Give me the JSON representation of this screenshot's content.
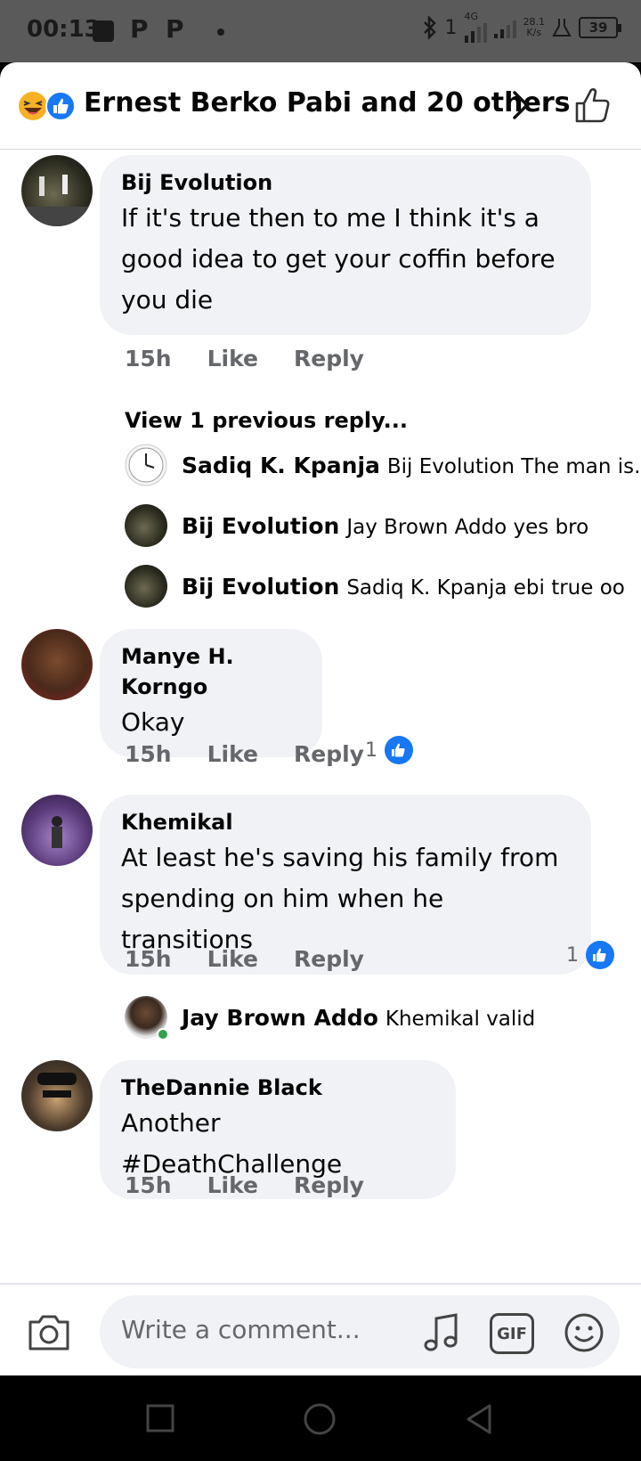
{
  "status_bar": {
    "time": "00:13",
    "network": "4G",
    "sim_slot": "1",
    "speed_value": "28.1",
    "speed_unit": "K/s",
    "battery": "39"
  },
  "header": {
    "title": "Ernest Berko Pabi and 20 others"
  },
  "comments": [
    {
      "name": "Bij Evolution",
      "text": "If it's true then to me I think it's a good idea to get your coffin before you die",
      "time": "15h",
      "like_label": "Like",
      "reply_label": "Reply"
    },
    {
      "name": "Manye H. Korngo",
      "text": "Okay",
      "time": "15h",
      "like_label": "Like",
      "reply_label": "Reply",
      "like_count": "1"
    },
    {
      "name": "Khemikal",
      "text": "At least he's saving his family from spending on him when he transitions",
      "time": "15h",
      "like_label": "Like",
      "reply_label": "Reply",
      "like_count": "1"
    },
    {
      "name": "TheDannie Black",
      "text": "Another #DeathChallenge",
      "time": "15h",
      "like_label": "Like",
      "reply_label": "Reply"
    }
  ],
  "view_previous": "View 1 previous reply...",
  "replies": [
    {
      "name": "Sadiq K. Kpanja",
      "text": "Bij Evolution The man is..."
    },
    {
      "name": "Bij Evolution",
      "text": "Jay Brown Addo yes bro"
    },
    {
      "name": "Bij Evolution",
      "text": "Sadiq K. Kpanja ebi true oo"
    },
    {
      "name": "Jay Brown Addo",
      "text": "Khemikal valid"
    }
  ],
  "composer": {
    "placeholder": "Write a comment...",
    "gif_label": "GIF"
  },
  "colors": {
    "like_blue": "#1877f2",
    "bubble_bg": "#f0f2f5",
    "muted_text": "#65676b"
  }
}
